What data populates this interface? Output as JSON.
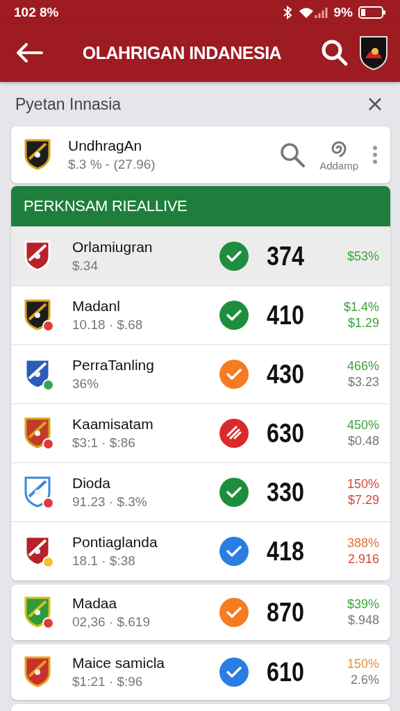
{
  "status_bar": {
    "left": "102 8%",
    "battery": "9%"
  },
  "app_bar": {
    "title": "OLAHRIGAN INDANESIA"
  },
  "filter": {
    "label": "Pyetan Innasia"
  },
  "top_card": {
    "name": "UndhragAn",
    "detail": "$.3 % - (27.96)",
    "action_label": "Addamp"
  },
  "section": {
    "title": "PERKNSAM RIEALLIVE"
  },
  "rows": [
    {
      "name": "Orlamiugran",
      "detail": "$.34",
      "selected": true,
      "status": {
        "kind": "check",
        "color": "#1e8e3e"
      },
      "score": "374",
      "changes": [
        {
          "text": "$53%",
          "color": "#3aa33a"
        }
      ]
    },
    {
      "name": "Madanl",
      "detail": "10.18 · $.68",
      "selected": false,
      "badge": {
        "color": "#e03a3a"
      },
      "status": {
        "kind": "check",
        "color": "#1e8e3e"
      },
      "score": "410",
      "changes": [
        {
          "text": "$1.4%",
          "color": "#3aa33a"
        },
        {
          "text": "$1.29",
          "color": "#3aa33a"
        }
      ]
    },
    {
      "name": "PerraTanling",
      "detail": "36%",
      "selected": false,
      "badge": {
        "color": "#2fa84f"
      },
      "status": {
        "kind": "check",
        "color": "#f57c22"
      },
      "score": "430",
      "changes": [
        {
          "text": "466%",
          "color": "#3aa33a"
        },
        {
          "text": "$3.23",
          "color": "#777777"
        }
      ]
    },
    {
      "name": "Kaamisatam",
      "detail": "$3:1 · $:86",
      "selected": false,
      "badge": {
        "color": "#e03a3a"
      },
      "status": {
        "kind": "flag",
        "color": "#d92b2b"
      },
      "score": "630",
      "changes": [
        {
          "text": "450%",
          "color": "#3aa33a"
        },
        {
          "text": "$0.48",
          "color": "#777777"
        }
      ]
    },
    {
      "name": "Dioda",
      "detail": "91.23 · $.3%",
      "selected": false,
      "badge": {
        "color": "#e03a3a"
      },
      "status": {
        "kind": "check",
        "color": "#1e8e3e"
      },
      "score": "330",
      "changes": [
        {
          "text": "150%",
          "color": "#d9463a"
        },
        {
          "text": "$7.29",
          "color": "#d9463a"
        }
      ]
    },
    {
      "name": "Pontiaglanda",
      "detail": "18.1 · $:38",
      "selected": false,
      "badge": {
        "color": "#f2c230"
      },
      "status": {
        "kind": "check",
        "color": "#2a7de1"
      },
      "score": "418",
      "changes": [
        {
          "text": "388%",
          "color": "#e0703a"
        },
        {
          "text": "2.916",
          "color": "#d9463a"
        }
      ]
    }
  ],
  "cards": [
    {
      "name": "Madaa",
      "detail": "02,36 · $.619",
      "badge": {
        "color": "#e03a3a"
      },
      "status": {
        "kind": "check",
        "color": "#f57c22"
      },
      "score": "870",
      "changes": [
        {
          "text": "$39%",
          "color": "#3aa33a"
        },
        {
          "text": "$.948",
          "color": "#777777"
        }
      ]
    },
    {
      "name": "Maice samicla",
      "detail": "$1:21 · $:96",
      "status": {
        "kind": "check",
        "color": "#2a7de1"
      },
      "score": "610",
      "changes": [
        {
          "text": "150%",
          "color": "#e8903a"
        },
        {
          "text": "2.6%",
          "color": "#777777"
        }
      ]
    }
  ]
}
